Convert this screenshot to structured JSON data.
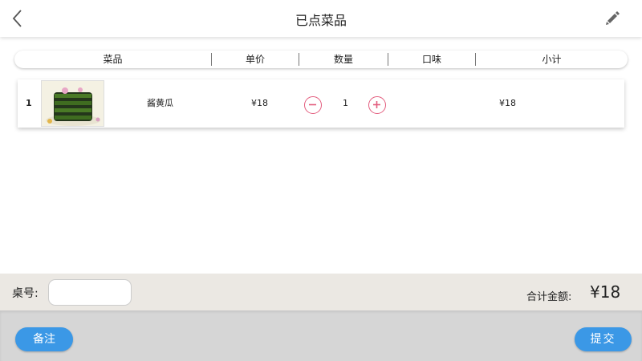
{
  "header": {
    "title": "已点菜品",
    "back_icon": "chevron-left-icon",
    "edit_icon": "pencil-icon"
  },
  "table": {
    "columns": [
      "菜品",
      "单价",
      "数量",
      "口味",
      "小计"
    ],
    "rows": [
      {
        "index": "1",
        "image": "dish-photo",
        "name": "酱黄瓜",
        "unit_price": "¥18",
        "quantity": "1",
        "taste": "",
        "subtotal": "¥18"
      }
    ]
  },
  "footer": {
    "table_label": "桌号:",
    "table_value": "",
    "total_label": "合计金额:",
    "total_value": "¥18"
  },
  "actions": {
    "note_label": "备注",
    "submit_label": "提交"
  },
  "colors": {
    "accent_blue": "#3b98e6",
    "qty_button": "#e35d7e",
    "footer_bg": "#ebe8e3",
    "bottom_bg": "#d6d6d6"
  }
}
